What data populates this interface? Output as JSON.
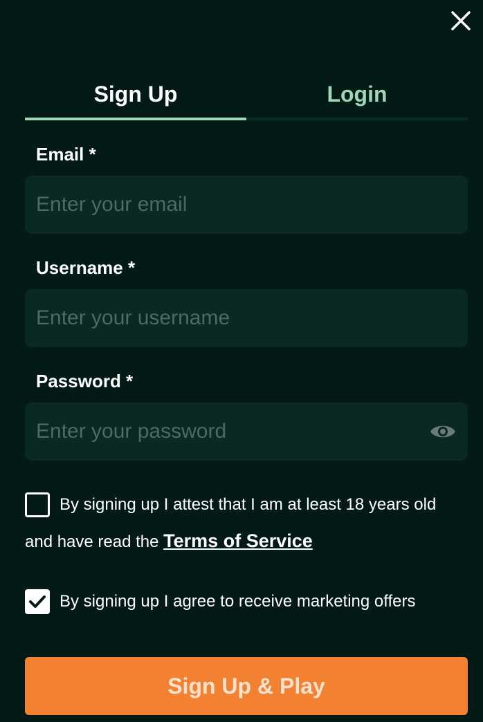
{
  "tabs": [
    {
      "label": "Sign Up",
      "active": true
    },
    {
      "label": "Login",
      "active": false
    }
  ],
  "form": {
    "email": {
      "label": "Email *",
      "placeholder": "Enter your email",
      "value": ""
    },
    "username": {
      "label": "Username *",
      "placeholder": "Enter your username",
      "value": ""
    },
    "password": {
      "label": "Password *",
      "placeholder": "Enter your password",
      "value": ""
    }
  },
  "checkboxes": {
    "age": {
      "checked": false,
      "line1": "By signing up I attest that I am at least 18 years old",
      "line2": "and have read the",
      "link": "Terms of Service"
    },
    "marketing": {
      "checked": true,
      "text": "By signing up I agree to receive marketing offers"
    }
  },
  "submit_label": "Sign Up & Play",
  "colors": {
    "background": "#041a17",
    "accent": "#9ed8b9",
    "button": "#f28232",
    "field": "#0a2923"
  },
  "icons": {
    "close": "close-icon",
    "eye": "eye-icon",
    "check": "check-icon"
  }
}
